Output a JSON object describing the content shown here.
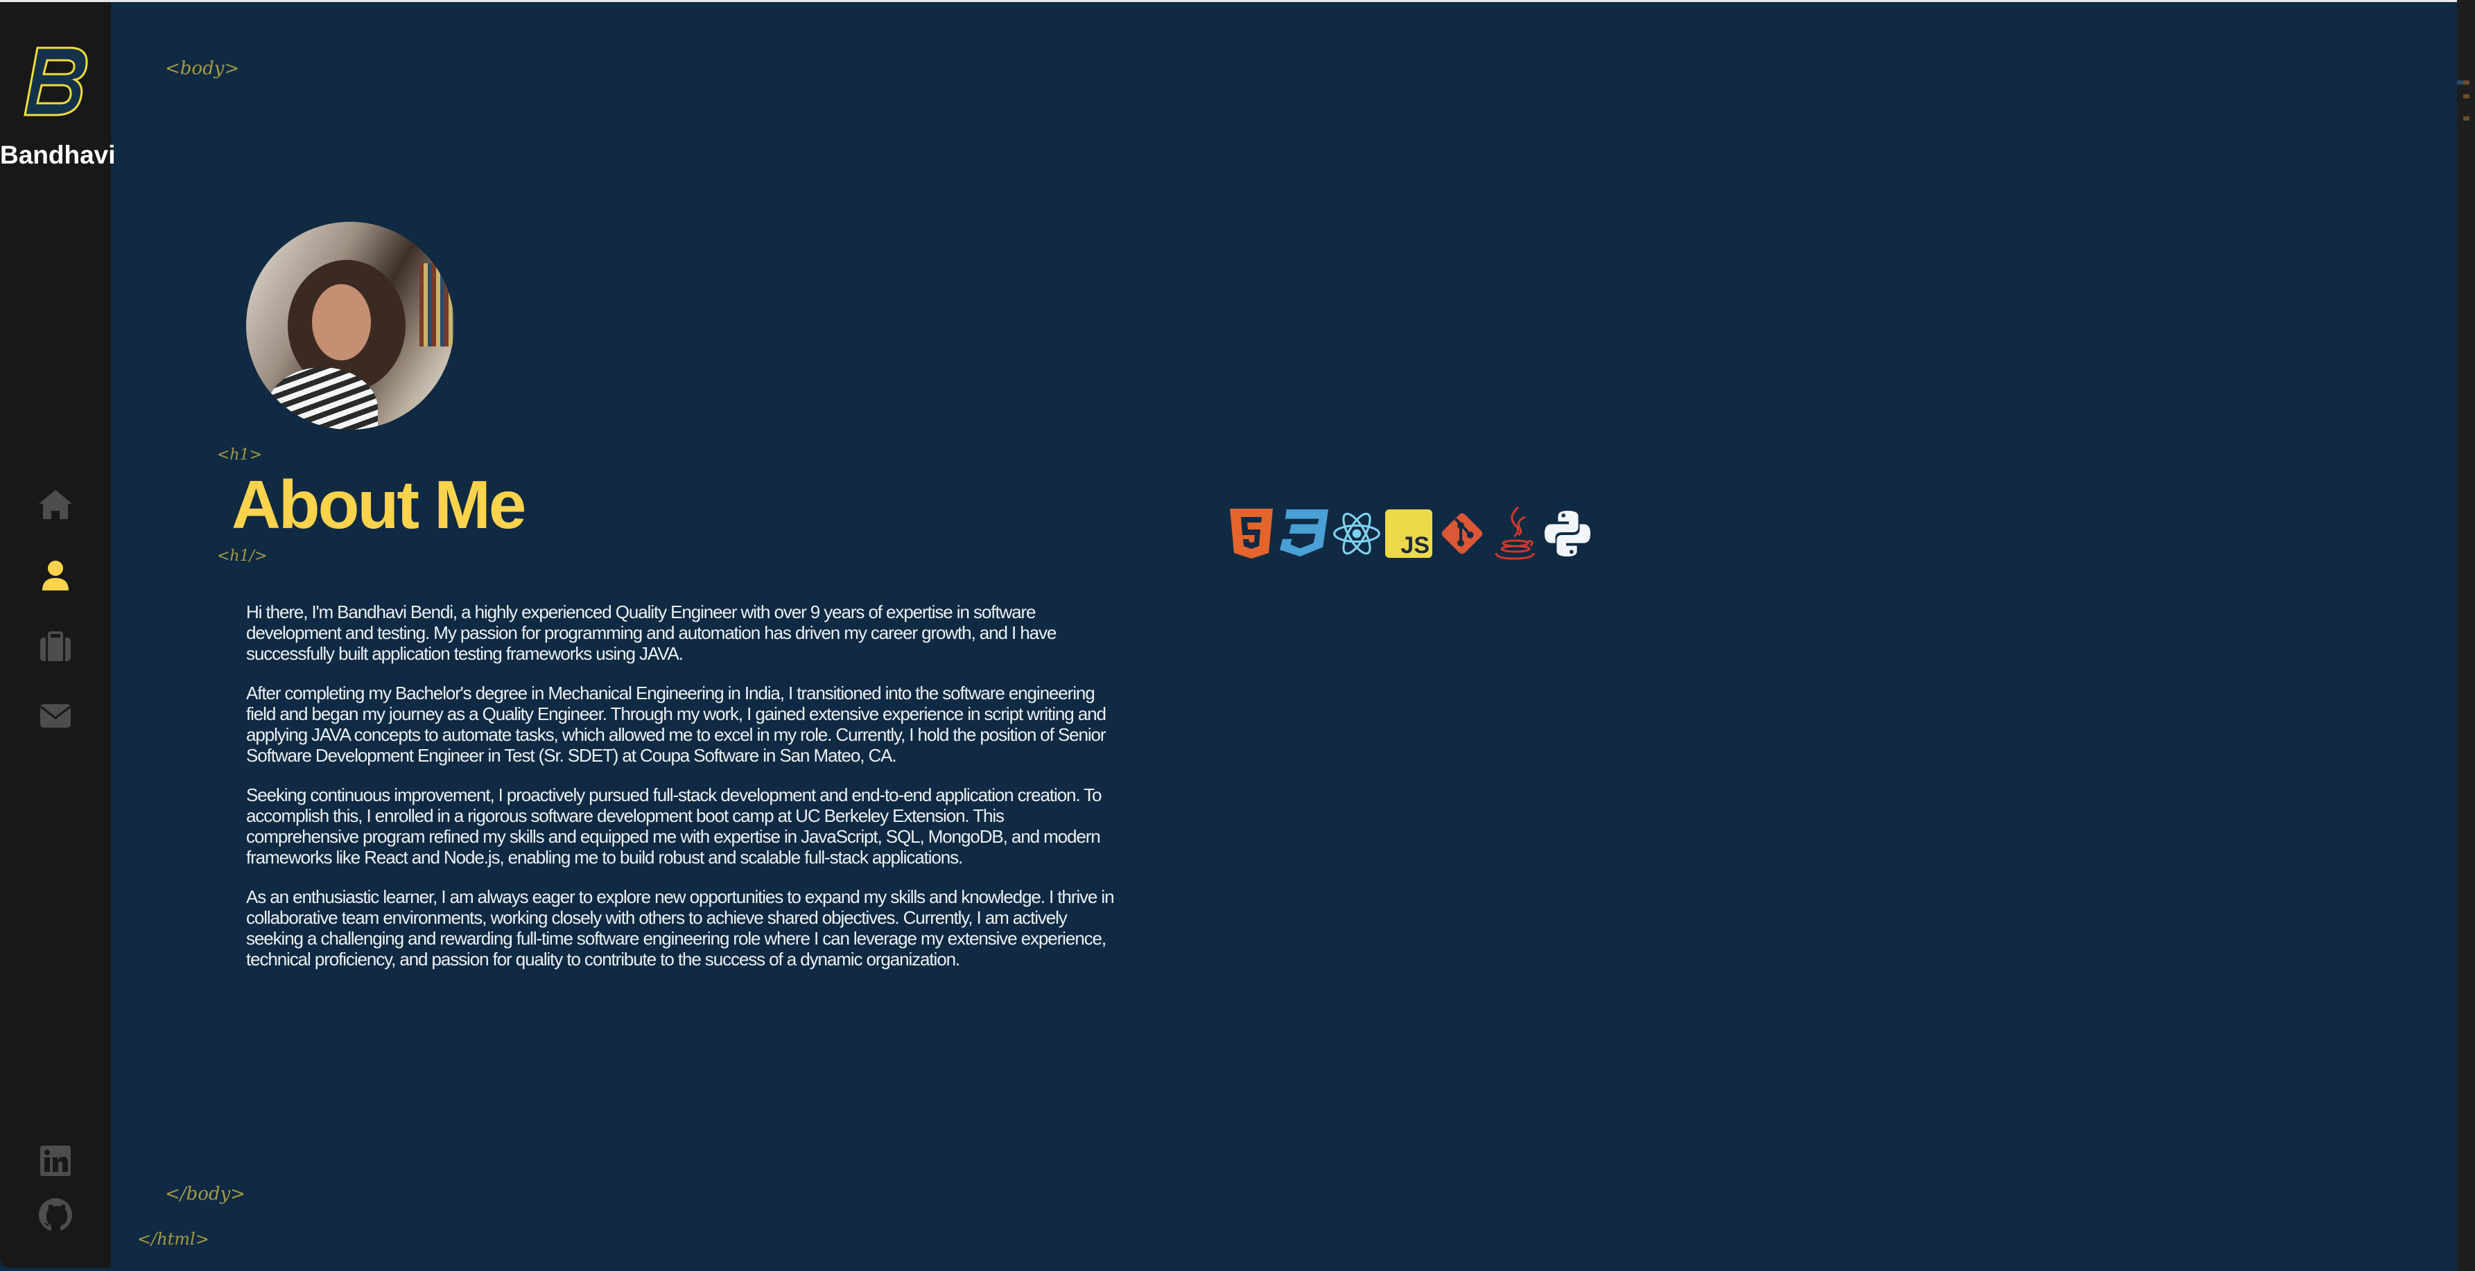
{
  "sidebar": {
    "logo_letter": "B",
    "brand_name": "Bandhavi",
    "nav": [
      {
        "name": "home",
        "icon": "home-icon",
        "active": false
      },
      {
        "name": "about",
        "icon": "user-icon",
        "active": true
      },
      {
        "name": "portfolio",
        "icon": "briefcase-icon",
        "active": false
      },
      {
        "name": "contact",
        "icon": "envelope-icon",
        "active": false
      }
    ],
    "social": [
      {
        "name": "linkedin",
        "icon": "linkedin-icon"
      },
      {
        "name": "github",
        "icon": "github-icon"
      }
    ]
  },
  "tags": {
    "body_open": "<body>",
    "h1_open": "<h1>",
    "h1_close": "<h1/>",
    "body_close": "</body>",
    "html_close": "</html>"
  },
  "main": {
    "title": "About Me",
    "paragraphs": [
      "Hi there, I'm Bandhavi Bendi, a highly experienced Quality Engineer with over 9 years of expertise in software development and testing. My passion for programming and automation has driven my career growth, and I have successfully built application testing frameworks using JAVA.",
      "After completing my Bachelor's degree in Mechanical Engineering in India, I transitioned into the software engineering field and began my journey as a Quality Engineer. Through my work, I gained extensive experience in script writing and applying JAVA concepts to automate tasks, which allowed me to excel in my role. Currently, I hold the position of Senior Software Development Engineer in Test (Sr. SDET) at Coupa Software in San Mateo, CA.",
      "Seeking continuous improvement, I proactively pursued full-stack development and end-to-end application creation. To accomplish this, I enrolled in a rigorous software development boot camp at UC Berkeley Extension. This comprehensive program refined my skills and equipped me with expertise in JavaScript, SQL, MongoDB, and modern frameworks like React and Node.js, enabling me to build robust and scalable full-stack applications.",
      "As an enthusiastic learner, I am always eager to explore new opportunities to expand my skills and knowledge. I thrive in collaborative team environments, working closely with others to achieve shared objectives. Currently, I am actively seeking a challenging and rewarding full-time software engineering role where I can leverage my extensive experience, technical proficiency, and passion for quality to contribute to the success of a dynamic organization."
    ],
    "skills": [
      "html5-icon",
      "css3-icon",
      "react-icon",
      "javascript-icon",
      "git-icon",
      "java-icon",
      "python-icon"
    ],
    "skill_js_label": "JS"
  },
  "colors": {
    "background": "#0f2a42",
    "sidebar": "#181818",
    "accent": "#fcd34d",
    "nav_inactive": "#4d4d4d",
    "tag": "#a39a48"
  }
}
